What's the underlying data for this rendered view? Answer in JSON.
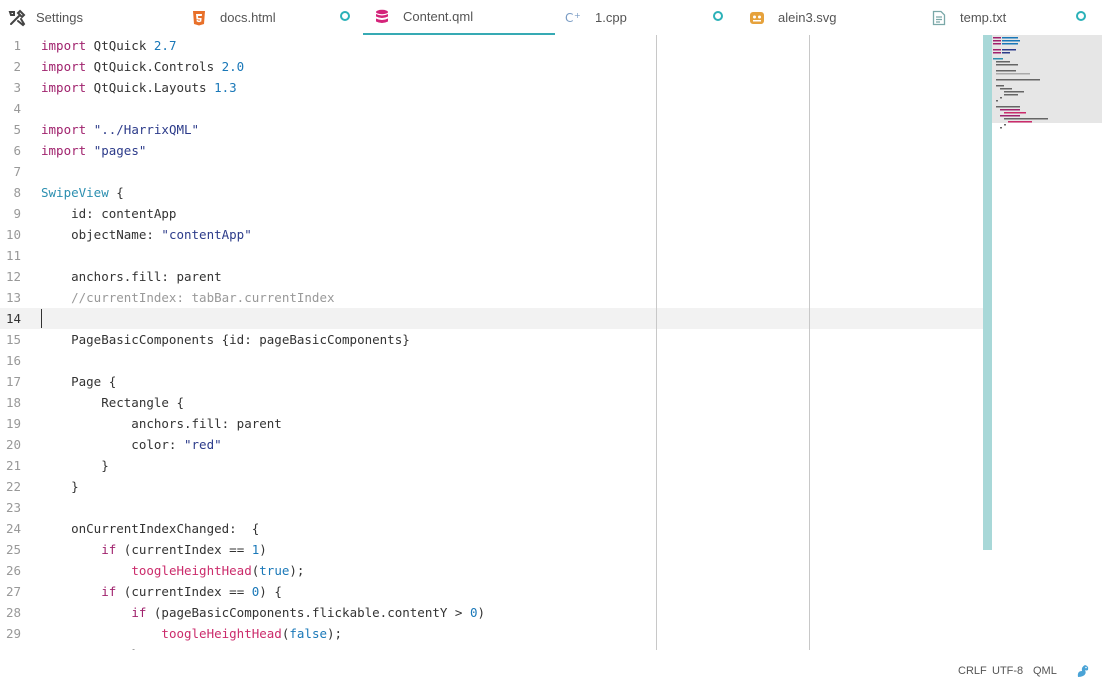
{
  "tabs": [
    {
      "label": "Settings",
      "icon": "tools-icon"
    },
    {
      "label": "docs.html",
      "icon": "html5-icon"
    },
    {
      "label": "Content.qml",
      "icon": "database-icon"
    },
    {
      "label": "1.cpp",
      "icon": "cpp-icon"
    },
    {
      "label": "alein3.svg",
      "icon": "image-icon"
    },
    {
      "label": "temp.txt",
      "icon": "text-file-icon"
    }
  ],
  "editor": {
    "current_line": 14,
    "lines": [
      [
        [
          "import",
          "kw"
        ],
        [
          " QtQuick ",
          ""
        ],
        [
          "2.7",
          "num"
        ]
      ],
      [
        [
          "import",
          "kw"
        ],
        [
          " QtQuick.Controls ",
          ""
        ],
        [
          "2.0",
          "num"
        ]
      ],
      [
        [
          "import",
          "kw"
        ],
        [
          " QtQuick.Layouts ",
          ""
        ],
        [
          "1.3",
          "num"
        ]
      ],
      [],
      [
        [
          "import",
          "kw"
        ],
        [
          " ",
          ""
        ],
        [
          "\"../HarrixQML\"",
          "str"
        ]
      ],
      [
        [
          "import",
          "kw"
        ],
        [
          " ",
          ""
        ],
        [
          "\"pages\"",
          "str"
        ]
      ],
      [],
      [
        [
          "SwipeView",
          "typ"
        ],
        [
          " {",
          ""
        ]
      ],
      [
        [
          "    id: contentApp",
          ""
        ]
      ],
      [
        [
          "    objectName: ",
          ""
        ],
        [
          "\"contentApp\"",
          "str"
        ]
      ],
      [],
      [
        [
          "    anchors.fill: parent",
          ""
        ]
      ],
      [
        [
          "    //currentIndex: tabBar.currentIndex",
          "cmt"
        ]
      ],
      [],
      [
        [
          "    PageBasicComponents {id: pageBasicComponents}",
          ""
        ]
      ],
      [],
      [
        [
          "    Page {",
          ""
        ]
      ],
      [
        [
          "        Rectangle {",
          ""
        ]
      ],
      [
        [
          "            anchors.fill: parent",
          ""
        ]
      ],
      [
        [
          "            color: ",
          ""
        ],
        [
          "\"red\"",
          "str"
        ]
      ],
      [
        [
          "        }",
          ""
        ]
      ],
      [
        [
          "    }",
          ""
        ]
      ],
      [],
      [
        [
          "    onCurrentIndexChanged:  {",
          ""
        ]
      ],
      [
        [
          "        ",
          ""
        ],
        [
          "if",
          "kw"
        ],
        [
          " (currentIndex == ",
          ""
        ],
        [
          "1",
          "num"
        ],
        [
          ")",
          ""
        ]
      ],
      [
        [
          "            ",
          ""
        ],
        [
          "toogleHeightHead",
          "fn"
        ],
        [
          "(",
          ""
        ],
        [
          "true",
          "bool"
        ],
        [
          ");",
          ""
        ]
      ],
      [
        [
          "        ",
          ""
        ],
        [
          "if",
          "kw"
        ],
        [
          " (currentIndex == ",
          ""
        ],
        [
          "0",
          "num"
        ],
        [
          ") {",
          ""
        ]
      ],
      [
        [
          "            ",
          ""
        ],
        [
          "if",
          "kw"
        ],
        [
          " (pageBasicComponents.flickable.contentY > ",
          ""
        ],
        [
          "0",
          "num"
        ],
        [
          ")",
          ""
        ]
      ],
      [
        [
          "                ",
          ""
        ],
        [
          "toogleHeightHead",
          "fn"
        ],
        [
          "(",
          ""
        ],
        [
          "false",
          "bool"
        ],
        [
          ");",
          ""
        ]
      ],
      [
        [
          "            }",
          ""
        ]
      ]
    ]
  },
  "status": {
    "line_ending": "CRLF",
    "encoding": "UTF-8",
    "language": "QML",
    "mascot_icon": "squirrel-icon"
  },
  "colors": {
    "accent": "#36aab4",
    "keyword": "#a0226d",
    "number": "#1a78b8",
    "comment": "#999999"
  }
}
